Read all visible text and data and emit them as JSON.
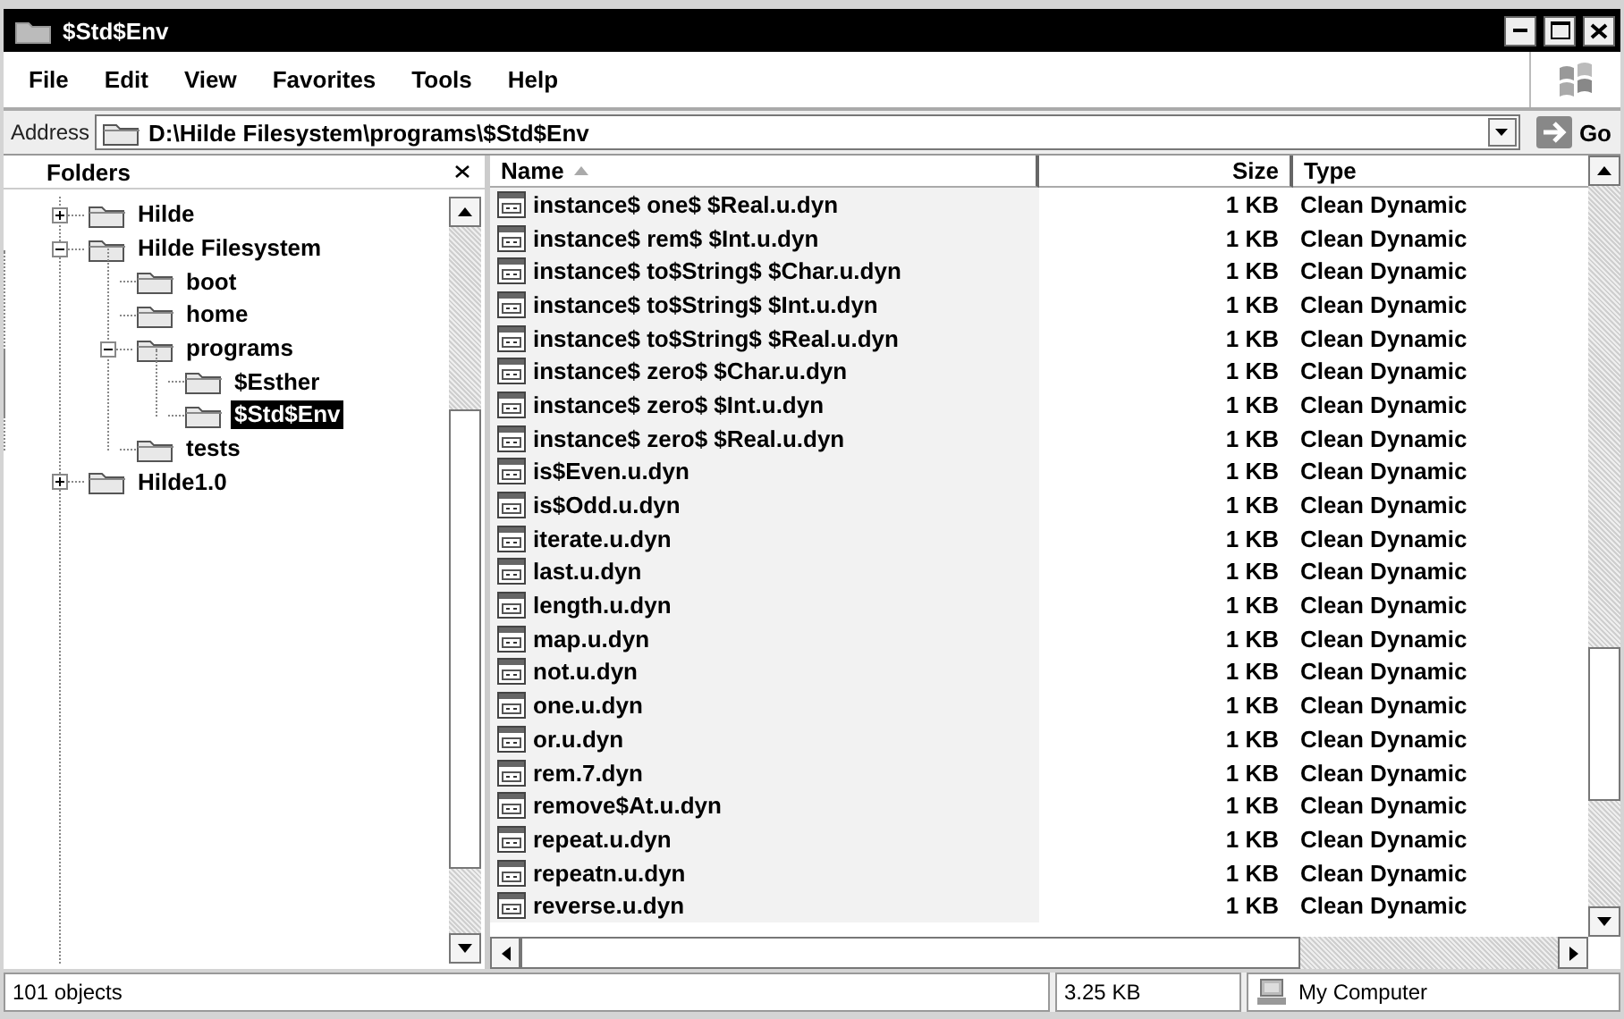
{
  "window": {
    "title": "$Std$Env"
  },
  "menu": [
    "File",
    "Edit",
    "View",
    "Favorites",
    "Tools",
    "Help"
  ],
  "address": {
    "label": "Address",
    "value": "D:\\Hilde Filesystem\\programs\\$Std$Env",
    "go": "Go"
  },
  "folders": {
    "title": "Folders",
    "tree": [
      {
        "label": "Hilde",
        "expanded": false,
        "selected": false
      },
      {
        "label": "Hilde Filesystem",
        "expanded": true,
        "selected": false,
        "children": [
          {
            "label": "boot",
            "selected": false
          },
          {
            "label": "home",
            "selected": false
          },
          {
            "label": "programs",
            "expanded": true,
            "selected": false,
            "children": [
              {
                "label": "$Esther",
                "selected": false
              },
              {
                "label": "$Std$Env",
                "selected": true
              }
            ]
          },
          {
            "label": "tests",
            "selected": false
          }
        ]
      },
      {
        "label": "Hilde1.0",
        "expanded": false,
        "selected": false
      }
    ]
  },
  "files": {
    "columns": [
      {
        "label": "Name",
        "sorted": true
      },
      {
        "label": "Size",
        "sorted": false
      },
      {
        "label": "Type",
        "sorted": false
      }
    ],
    "rows": [
      {
        "name": "instance$ one$ $Real.u.dyn",
        "size": "1 KB",
        "type": "Clean Dynamic"
      },
      {
        "name": "instance$ rem$ $Int.u.dyn",
        "size": "1 KB",
        "type": "Clean Dynamic"
      },
      {
        "name": "instance$ to$String$ $Char.u.dyn",
        "size": "1 KB",
        "type": "Clean Dynamic"
      },
      {
        "name": "instance$ to$String$ $Int.u.dyn",
        "size": "1 KB",
        "type": "Clean Dynamic"
      },
      {
        "name": "instance$ to$String$ $Real.u.dyn",
        "size": "1 KB",
        "type": "Clean Dynamic"
      },
      {
        "name": "instance$ zero$ $Char.u.dyn",
        "size": "1 KB",
        "type": "Clean Dynamic"
      },
      {
        "name": "instance$ zero$ $Int.u.dyn",
        "size": "1 KB",
        "type": "Clean Dynamic"
      },
      {
        "name": "instance$ zero$ $Real.u.dyn",
        "size": "1 KB",
        "type": "Clean Dynamic"
      },
      {
        "name": "is$Even.u.dyn",
        "size": "1 KB",
        "type": "Clean Dynamic"
      },
      {
        "name": "is$Odd.u.dyn",
        "size": "1 KB",
        "type": "Clean Dynamic"
      },
      {
        "name": "iterate.u.dyn",
        "size": "1 KB",
        "type": "Clean Dynamic"
      },
      {
        "name": "last.u.dyn",
        "size": "1 KB",
        "type": "Clean Dynamic"
      },
      {
        "name": "length.u.dyn",
        "size": "1 KB",
        "type": "Clean Dynamic"
      },
      {
        "name": "map.u.dyn",
        "size": "1 KB",
        "type": "Clean Dynamic"
      },
      {
        "name": "not.u.dyn",
        "size": "1 KB",
        "type": "Clean Dynamic"
      },
      {
        "name": "one.u.dyn",
        "size": "1 KB",
        "type": "Clean Dynamic"
      },
      {
        "name": "or.u.dyn",
        "size": "1 KB",
        "type": "Clean Dynamic"
      },
      {
        "name": "rem.7.dyn",
        "size": "1 KB",
        "type": "Clean Dynamic"
      },
      {
        "name": "remove$At.u.dyn",
        "size": "1 KB",
        "type": "Clean Dynamic"
      },
      {
        "name": "repeat.u.dyn",
        "size": "1 KB",
        "type": "Clean Dynamic"
      },
      {
        "name": "repeatn.u.dyn",
        "size": "1 KB",
        "type": "Clean Dynamic"
      },
      {
        "name": "reverse.u.dyn",
        "size": "1 KB",
        "type": "Clean Dynamic"
      }
    ]
  },
  "status_bar": {
    "objects": "101 objects",
    "size": "3.25 KB",
    "zone": "My Computer"
  }
}
